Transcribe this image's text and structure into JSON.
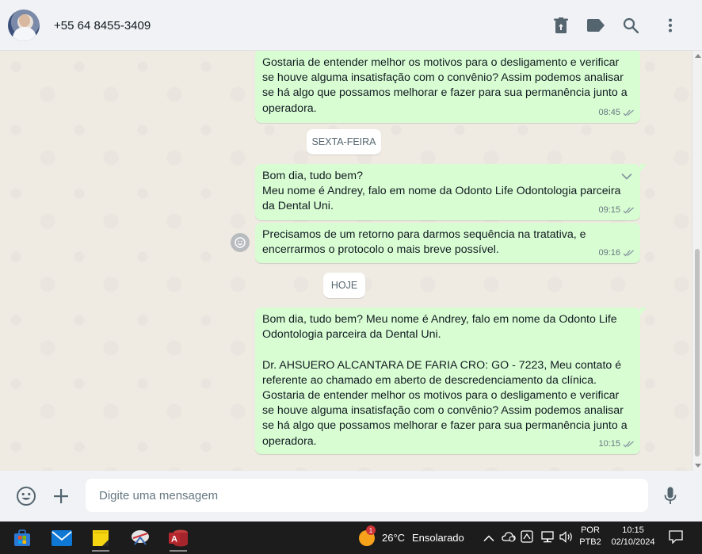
{
  "header": {
    "contact_name": "+55 64 8455-3409",
    "icons": [
      "trash-icon",
      "label-icon",
      "search-icon",
      "more-vertical-icon"
    ]
  },
  "chat": {
    "messages": [
      {
        "text": "Gostaria de entender melhor os motivos para o desligamento e verificar se houve alguma insatisfação com o convênio? Assim podemos analisar se há algo que possamos melhorar e fazer para sua permanência junto a operadora.",
        "time": "08:45"
      },
      {
        "text": "Bom dia, tudo bem?\nMeu nome é Andrey, falo em nome da Odonto Life Odontologia parceira da Dental Uni.",
        "time": "09:15"
      },
      {
        "text": "Precisamos de um retorno para darmos sequência na tratativa, e encerrarmos o protocolo o mais breve possível.",
        "time": "09:16"
      },
      {
        "text": "Bom dia, tudo bem? Meu nome é Andrey, falo em nome da Odonto Life Odontologia parceira da Dental Uni.\n\nDr. AHSUERO ALCANTARA DE FARIA CRO: GO - 7223, Meu contato é referente ao chamado em aberto de descredenciamento da clínica.\nGostaria de entender melhor os motivos para o desligamento e verificar se houve alguma insatisfação com o convênio? Assim podemos analisar se há algo que possamos melhorar e fazer para sua permanência junto a operadora.",
        "time": "10:15"
      }
    ],
    "date_separators": [
      "SEXTA-FEIRA",
      "HOJE"
    ]
  },
  "composer": {
    "placeholder": "Digite uma mensagem"
  },
  "taskbar": {
    "weather_temp": "26°C",
    "weather_desc": "Ensolarado",
    "weather_badge": "1",
    "lang_top": "POR",
    "lang_bottom": "PTB2",
    "time": "10:15",
    "date": "02/10/2024"
  },
  "colors": {
    "bubble_out": "#d9fdd3",
    "chat_bg": "#efeae2",
    "header_bg": "#f0f2f5",
    "icon": "#54656f"
  }
}
